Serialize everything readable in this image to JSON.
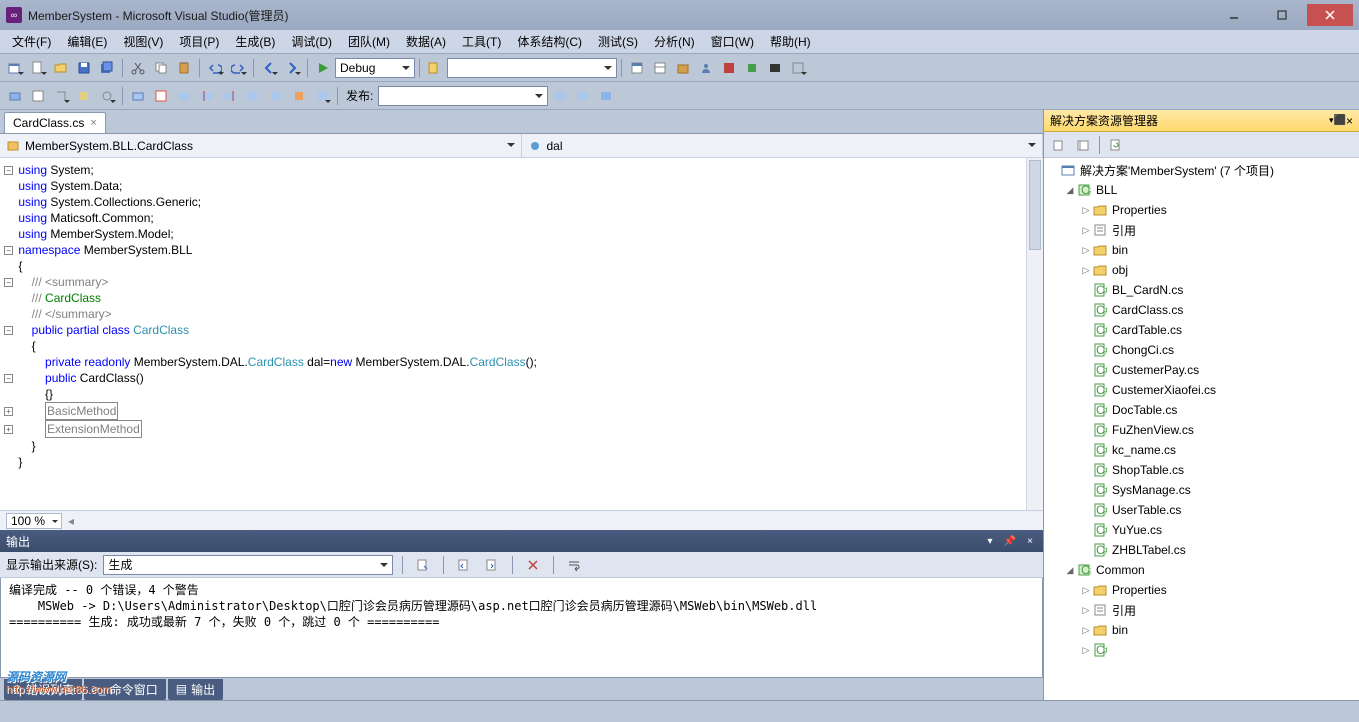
{
  "title": "MemberSystem - Microsoft Visual Studio(管理员)",
  "menu": [
    "文件(F)",
    "编辑(E)",
    "视图(V)",
    "项目(P)",
    "生成(B)",
    "调试(D)",
    "团队(M)",
    "数据(A)",
    "工具(T)",
    "体系结构(C)",
    "测试(S)",
    "分析(N)",
    "窗口(W)",
    "帮助(H)"
  ],
  "toolbar1": {
    "config": "Debug",
    "launch_label": "发布:"
  },
  "tab": {
    "name": "CardClass.cs"
  },
  "nav": {
    "left": "MemberSystem.BLL.CardClass",
    "right": "dal"
  },
  "zoom": "100 %",
  "code_lines": [
    {
      "fold": "-",
      "html": "<span class='k'>using</span> System;"
    },
    {
      "fold": "",
      "html": "<span class='k'>using</span> System.Data;"
    },
    {
      "fold": "",
      "html": "<span class='k'>using</span> System.Collections.Generic;"
    },
    {
      "fold": "",
      "html": "<span class='k'>using</span> Maticsoft.Common;"
    },
    {
      "fold": "",
      "html": "<span class='k'>using</span> MemberSystem.Model;"
    },
    {
      "fold": "-",
      "html": "<span class='k'>namespace</span> MemberSystem.BLL"
    },
    {
      "fold": "",
      "html": "{"
    },
    {
      "fold": "-",
      "html": "    <span class='c2'>/// &lt;summary&gt;</span>"
    },
    {
      "fold": "",
      "html": "    <span class='c2'>///</span> <span class='c'>CardClass</span>"
    },
    {
      "fold": "",
      "html": "    <span class='c2'>/// &lt;/summary&gt;</span>"
    },
    {
      "fold": "-",
      "html": "    <span class='k'>public</span> <span class='k'>partial</span> <span class='k'>class</span> <span class='t'>CardClass</span>"
    },
    {
      "fold": "",
      "html": "    {"
    },
    {
      "fold": "",
      "html": "        <span class='k'>private</span> <span class='k'>readonly</span> MemberSystem.DAL.<span class='t'>CardClass</span> dal=<span class='k'>new</span> MemberSystem.DAL.<span class='t'>CardClass</span>();"
    },
    {
      "fold": "-",
      "html": "        <span class='k'>public</span> CardClass()"
    },
    {
      "fold": "",
      "html": "        {}"
    },
    {
      "fold": "+",
      "html": "        <span class='box'>BasicMethod</span>"
    },
    {
      "fold": "+",
      "html": "        <span class='box'>ExtensionMethod</span>"
    },
    {
      "fold": "",
      "html": "    }"
    },
    {
      "fold": "",
      "html": "}"
    }
  ],
  "output": {
    "title": "输出",
    "source_label": "显示输出来源(S):",
    "source": "生成",
    "text": "编译完成 -- 0 个错误，4 个警告\n    MSWeb -> D:\\Users\\Administrator\\Desktop\\口腔门诊会员病历管理源码\\asp.net口腔门诊会员病历管理源码\\MSWeb\\bin\\MSWeb.dll\n========== 生成: 成功或最新 7 个，失败 0 个，跳过 0 个 =========="
  },
  "bottom_tabs": [
    {
      "icon": "⊘",
      "label": "错误列表"
    },
    {
      "icon": ">_",
      "label": "命令窗口"
    },
    {
      "icon": "▤",
      "label": "输出"
    }
  ],
  "solution": {
    "title": "解决方案资源管理器",
    "root": "解决方案'MemberSystem' (7 个项目)",
    "bll": {
      "name": "BLL",
      "folders": [
        "Properties",
        "引用",
        "bin",
        "obj"
      ],
      "files": [
        "BL_CardN.cs",
        "CardClass.cs",
        "CardTable.cs",
        "ChongCi.cs",
        "CustemerPay.cs",
        "CustemerXiaofei.cs",
        "DocTable.cs",
        "FuZhenView.cs",
        "kc_name.cs",
        "ShopTable.cs",
        "SysManage.cs",
        "UserTable.cs",
        "YuYue.cs",
        "ZHBLTabel.cs"
      ]
    },
    "common": {
      "name": "Common",
      "folders": [
        "Properties",
        "引用",
        "bin"
      ]
    }
  },
  "watermark": {
    "text": "源码资源网",
    "url": "http://www.net86.com"
  }
}
